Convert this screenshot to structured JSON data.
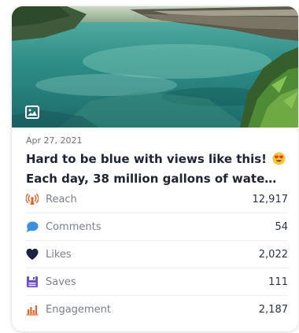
{
  "post": {
    "date": "Apr 27, 2021",
    "caption_line1": "Hard to be blue with views like this!",
    "caption_line2": "Each day, 38 million gallons of wate…",
    "media_type": "image-icon"
  },
  "stats": [
    {
      "label": "Reach",
      "value": "12,917",
      "icon": "reach-icon",
      "color": "#e8632b"
    },
    {
      "label": "Comments",
      "value": "54",
      "icon": "comment-icon",
      "color": "#3d8fe0"
    },
    {
      "label": "Likes",
      "value": "2,022",
      "icon": "heart-icon",
      "color": "#1f2340"
    },
    {
      "label": "Saves",
      "value": "111",
      "icon": "save-icon",
      "color": "#6a4fc9"
    },
    {
      "label": "Engagement",
      "value": "2,187",
      "icon": "engagement-icon",
      "color": "#e8632b"
    }
  ]
}
